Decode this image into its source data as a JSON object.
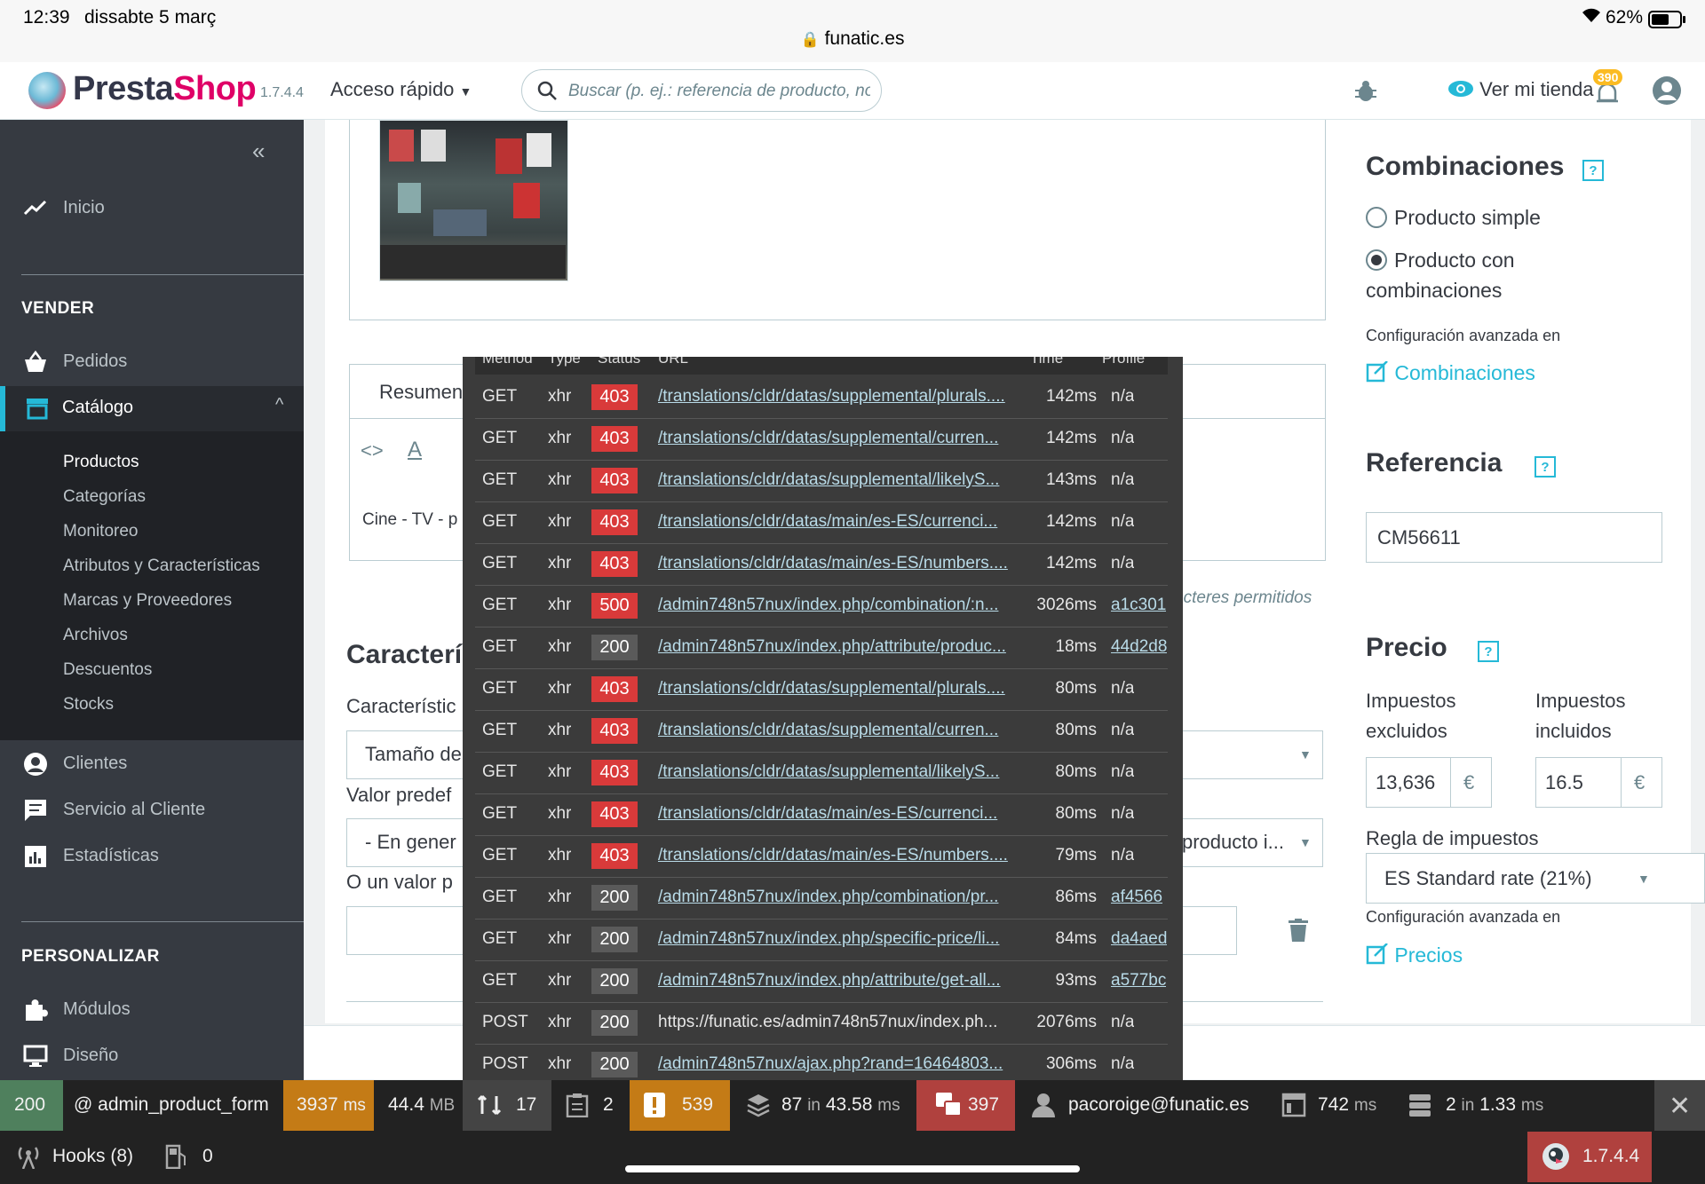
{
  "status_bar": {
    "time": "12:39",
    "date": "dissabte 5 març",
    "url": "funatic.es",
    "battery": "62%"
  },
  "header": {
    "logo_word1": "Presta",
    "logo_word2": "Shop",
    "version": "1.7.4.4",
    "quick_access": "Acceso rápido",
    "search_placeholder": "Buscar (p. ej.: referencia de producto, no",
    "view_store": "Ver mi tienda",
    "notifications": "390"
  },
  "sidebar": {
    "inicio": "Inicio",
    "section_vender": "VENDER",
    "pedidos": "Pedidos",
    "catalogo": "Catálogo",
    "sub": [
      "Productos",
      "Categorías",
      "Monitoreo",
      "Atributos y Características",
      "Marcas y Proveedores",
      "Archivos",
      "Descuentos",
      "Stocks"
    ],
    "clientes": "Clientes",
    "servicio": "Servicio al Cliente",
    "estadisticas": "Estadísticas",
    "section_personalizar": "PERSONALIZAR",
    "modulos": "Módulos",
    "diseno": "Diseño"
  },
  "main": {
    "resumen_tab": "Resumen",
    "description_text": "Cine - TV - p",
    "chars_allowed": "acteres permitidos",
    "caracteristicas_title": "Caracterí",
    "caracteristica_label": "Característic",
    "caracteristica_select": "Tamaño de",
    "valor_label": "Valor predef",
    "valor_select": "- En gener",
    "valor_select_right": "producto i...",
    "o_valor_label": "O un valor p"
  },
  "right_panel": {
    "combinaciones_title": "Combinaciones",
    "producto_simple": "Producto simple",
    "producto_con_1": "Producto con",
    "producto_con_2": "combinaciones",
    "config_avanzada": "Configuración avanzada en",
    "combinaciones_link": "Combinaciones",
    "referencia_title": "Referencia",
    "referencia_value": "CM56611",
    "precio_title": "Precio",
    "imp_excl_1": "Impuestos",
    "imp_excl_2": "excluidos",
    "imp_incl_1": "Impuestos",
    "imp_incl_2": "incluidos",
    "price_excl": "13,636",
    "price_incl": "16.5",
    "currency": "€",
    "regla": "Regla de impuestos",
    "tax_rule": "ES Standard rate (21%)",
    "config_avanzada_2": "Configuración avanzada en",
    "precios_link": "Precios"
  },
  "debug": {
    "columns": [
      "Method",
      "Type",
      "Status",
      "URL",
      "Time",
      "Profile"
    ],
    "rows": [
      {
        "method": "GET",
        "type": "xhr",
        "status": "403",
        "url": "/translations/cldr/datas/supplemental/plurals....",
        "time": "142ms",
        "profile": "n/a"
      },
      {
        "method": "GET",
        "type": "xhr",
        "status": "403",
        "url": "/translations/cldr/datas/supplemental/curren...",
        "time": "142ms",
        "profile": "n/a"
      },
      {
        "method": "GET",
        "type": "xhr",
        "status": "403",
        "url": "/translations/cldr/datas/supplemental/likelyS...",
        "time": "143ms",
        "profile": "n/a"
      },
      {
        "method": "GET",
        "type": "xhr",
        "status": "403",
        "url": "/translations/cldr/datas/main/es-ES/currenci...",
        "time": "142ms",
        "profile": "n/a"
      },
      {
        "method": "GET",
        "type": "xhr",
        "status": "403",
        "url": "/translations/cldr/datas/main/es-ES/numbers....",
        "time": "142ms",
        "profile": "n/a"
      },
      {
        "method": "GET",
        "type": "xhr",
        "status": "500",
        "url": "/admin748n57nux/index.php/combination/:n...",
        "time": "3026ms",
        "profile": "a1c301"
      },
      {
        "method": "GET",
        "type": "xhr",
        "status": "200",
        "url": "/admin748n57nux/index.php/attribute/produc...",
        "time": "18ms",
        "profile": "44d2d8"
      },
      {
        "method": "GET",
        "type": "xhr",
        "status": "403",
        "url": "/translations/cldr/datas/supplemental/plurals....",
        "time": "80ms",
        "profile": "n/a"
      },
      {
        "method": "GET",
        "type": "xhr",
        "status": "403",
        "url": "/translations/cldr/datas/supplemental/curren...",
        "time": "80ms",
        "profile": "n/a"
      },
      {
        "method": "GET",
        "type": "xhr",
        "status": "403",
        "url": "/translations/cldr/datas/supplemental/likelyS...",
        "time": "80ms",
        "profile": "n/a"
      },
      {
        "method": "GET",
        "type": "xhr",
        "status": "403",
        "url": "/translations/cldr/datas/main/es-ES/currenci...",
        "time": "80ms",
        "profile": "n/a"
      },
      {
        "method": "GET",
        "type": "xhr",
        "status": "403",
        "url": "/translations/cldr/datas/main/es-ES/numbers....",
        "time": "79ms",
        "profile": "n/a"
      },
      {
        "method": "GET",
        "type": "xhr",
        "status": "200",
        "url": "/admin748n57nux/index.php/combination/pr...",
        "time": "86ms",
        "profile": "af4566"
      },
      {
        "method": "GET",
        "type": "xhr",
        "status": "200",
        "url": "/admin748n57nux/index.php/specific-price/li...",
        "time": "84ms",
        "profile": "da4aed"
      },
      {
        "method": "GET",
        "type": "xhr",
        "status": "200",
        "url": "/admin748n57nux/index.php/attribute/get-all...",
        "time": "93ms",
        "profile": "a577bc"
      },
      {
        "method": "POST",
        "type": "xhr",
        "status": "200",
        "url": "https://funatic.es/admin748n57nux/index.ph...",
        "time": "2076ms",
        "profile": "n/a"
      },
      {
        "method": "POST",
        "type": "xhr",
        "status": "200",
        "url": "/admin748n57nux/ajax.php?rand=16464803...",
        "time": "306ms",
        "profile": "n/a"
      }
    ]
  },
  "toolbar": {
    "status": "200",
    "route": "@ admin_product_form",
    "time": "3937",
    "time_unit": "ms",
    "memory": "44.4",
    "memory_unit": "MB",
    "ajax": "17",
    "forms": "2",
    "logs": "539",
    "cache": "87",
    "cache_in": "in",
    "cache_time": "43.58",
    "cache_unit": "ms",
    "translations": "397",
    "user": "pacoroige@funatic.es",
    "render": "742",
    "render_unit": "ms",
    "db": "2",
    "db_in": "in",
    "db_time": "1.33",
    "db_unit": "ms",
    "hooks": "Hooks (8)",
    "modules": "0",
    "ps_version": "1.7.4.4"
  },
  "colors": {
    "accent": "#25b9d7",
    "error": "#d93a3a",
    "warning": "#c47b16",
    "sidebar": "#363a41"
  }
}
